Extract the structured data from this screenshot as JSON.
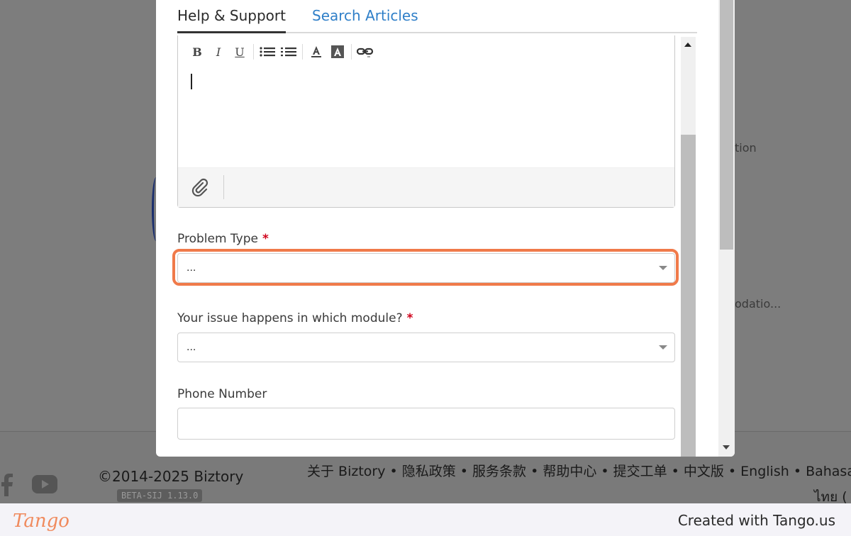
{
  "background": {
    "partial_text_1": "tion",
    "partial_text_2": "odatio...",
    "copyright": "©2014-2025 Biztory",
    "version_badge": "BETA-SIJ 1.13.0",
    "footer_links": "关于 Biztory • 隐私政策 • 服务条款 • 帮助中心 • 提交工单 • 中文版 • English • Bahasa Ma",
    "footer_thai": "ไทย ("
  },
  "modal": {
    "tabs": [
      {
        "label": "Help & Support",
        "active": true
      },
      {
        "label": "Search Articles",
        "active": false
      }
    ],
    "editor": {
      "toolbar": [
        "bold-icon",
        "italic-icon",
        "underline-icon",
        "bulleted-list-icon",
        "numbered-list-icon",
        "text-color-icon",
        "background-color-icon",
        "link-icon"
      ],
      "attachment_icon": "paperclip-icon"
    },
    "problem_type": {
      "label": "Problem Type",
      "required": "*",
      "value": "..."
    },
    "module": {
      "label": "Your issue happens in which module?",
      "required": "*",
      "value": "..."
    },
    "phone": {
      "label": "Phone Number",
      "value": ""
    }
  },
  "tango": {
    "logo": "Tango",
    "credit": "Created with Tango.us"
  },
  "colors": {
    "highlight": "#f07a4a",
    "active_tab_link": "#2f7fc8",
    "required": "#d0021b"
  }
}
